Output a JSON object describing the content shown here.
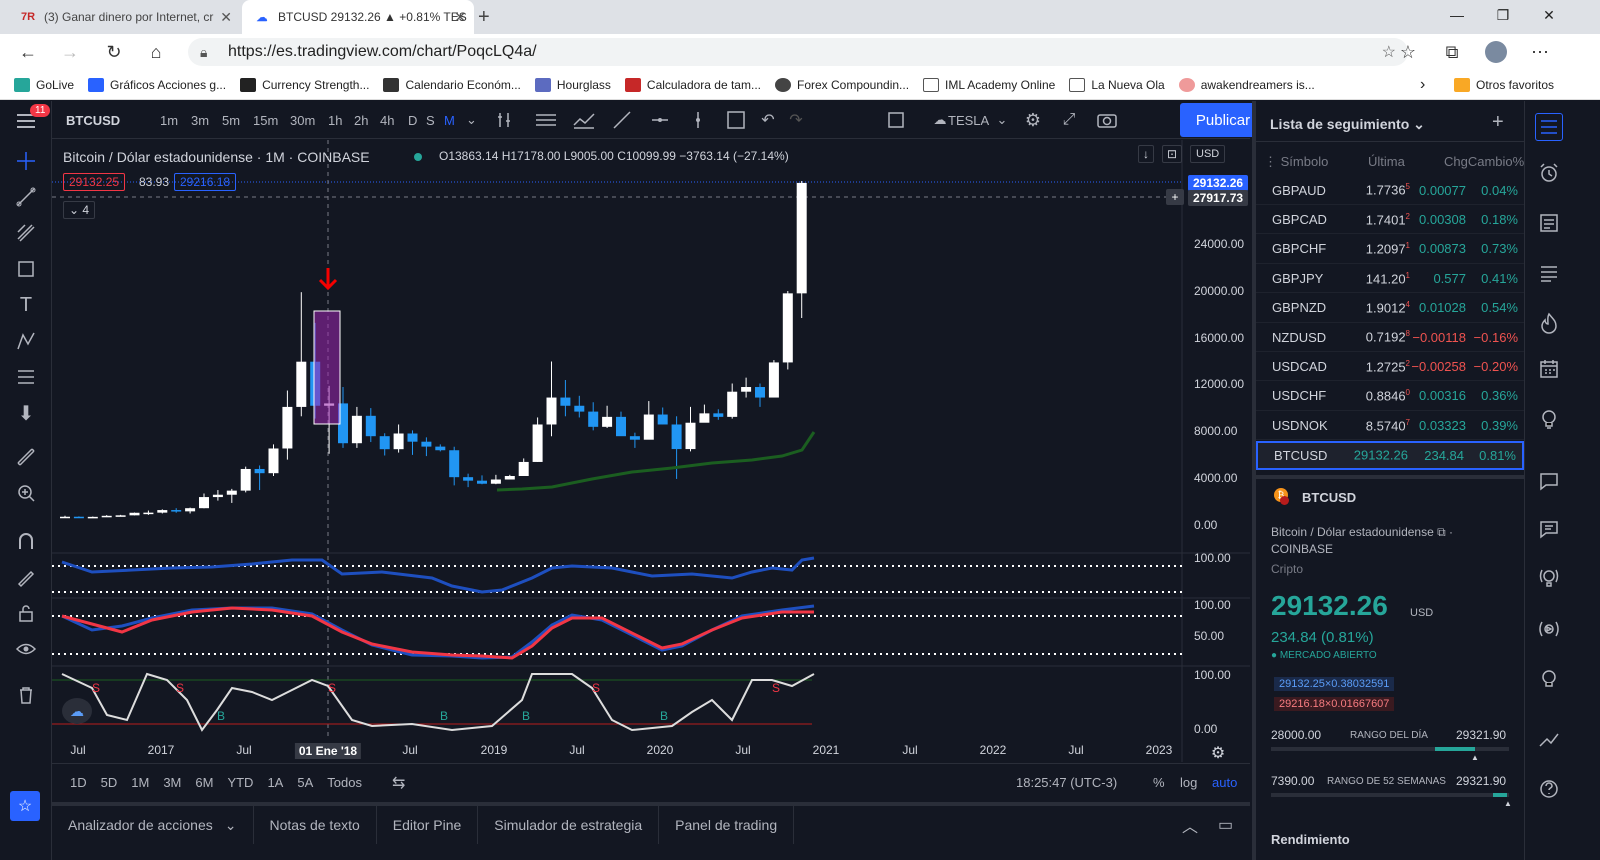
{
  "browser": {
    "tabs": [
      {
        "title": "(3) Ganar dinero por Internet, cr"
      },
      {
        "title": "BTCUSD 29132.26 ▲ +0.81% TES"
      }
    ],
    "url": "https://es.tradingview.com/chart/PoqcLQ4a/",
    "bookmarks": [
      "GoLive",
      "Gráficos Acciones g...",
      "Currency Strength...",
      "Calendario Económ...",
      "Hourglass",
      "Calculadora de tam...",
      "Forex Compoundin...",
      "IML Academy Online",
      "La Nueva Ola",
      "awakendreamers is..."
    ],
    "other_bookmarks": "Otros favoritos",
    "notification_count": "11"
  },
  "toolbar": {
    "symbol": "BTCUSD",
    "intervals": [
      "1m",
      "3m",
      "5m",
      "15m",
      "30m",
      "1h",
      "2h",
      "4h",
      "D",
      "S",
      "M"
    ],
    "active_interval": "M",
    "layout_name": "TESLA",
    "publish_label": "Publicar"
  },
  "chart": {
    "title": "Bitcoin / Dólar estadounidense · 1M · COINBASE",
    "ohlc": {
      "o": "O13863.14",
      "h": "H17178.00",
      "l": "L9005.00",
      "c": "C10099.99",
      "chg": "−3763.14 (−27.14%)"
    },
    "bid": "29132.25",
    "spread": "83.93",
    "ask": "29216.18",
    "indicators_count": "4",
    "currency": "USD",
    "last_price_label": "29132.26",
    "crosshair_price_label": "27917.73",
    "price_ticks": [
      "24000.00",
      "20000.00",
      "16000.00",
      "12000.00",
      "8000.00",
      "4000.00",
      "0.00"
    ],
    "osc1_ticks": [
      "100.00"
    ],
    "osc2_ticks": [
      "100.00",
      "50.00"
    ],
    "osc3_ticks": [
      "100.00",
      "0.00"
    ],
    "x_labels": [
      "Jul",
      "2017",
      "Jul",
      "Jul",
      "2019",
      "Jul",
      "2020",
      "Jul",
      "2021",
      "Jul",
      "2022",
      "Jul",
      "2023"
    ],
    "crosshair_date": "01 Ene '18",
    "signal_s": "S",
    "signal_b": "B",
    "colors": {
      "up": "#ffffff",
      "down": "#2196f3",
      "ma": "#1b5e20",
      "osc_blue": "#1e4fbf",
      "osc_red": "#f23645"
    }
  },
  "chart_data": {
    "type": "candlestick",
    "title": "Bitcoin / Dólar estadounidense · 1M · COINBASE",
    "ylim": [
      0,
      30000
    ],
    "candles_approx": [
      {
        "date": "2016-07",
        "close": 620
      },
      {
        "date": "2017-01",
        "close": 970
      },
      {
        "date": "2017-07",
        "close": 2850
      },
      {
        "date": "2017-12",
        "close": 13863
      },
      {
        "date": "2018-01",
        "close": 10100
      },
      {
        "date": "2018-12",
        "close": 3700
      },
      {
        "date": "2019-06",
        "close": 10800
      },
      {
        "date": "2020-03",
        "close": 6400
      },
      {
        "date": "2020-11",
        "close": 19700
      },
      {
        "date": "2020-12",
        "close": 29132
      }
    ],
    "last": 29132.26
  },
  "range_bar": {
    "ranges": [
      "1D",
      "5D",
      "1M",
      "3M",
      "6M",
      "YTD",
      "1A",
      "5A",
      "Todos"
    ],
    "time": "18:25:47 (UTC-3)",
    "pct": "%",
    "log": "log",
    "auto": "auto"
  },
  "bottom_tabs": [
    "Analizador de acciones",
    "Notas de texto",
    "Editor Pine",
    "Simulador de estrategia",
    "Panel de trading"
  ],
  "watchlist": {
    "title": "Lista de seguimiento",
    "headers": {
      "symbol": "Símbolo",
      "last": "Última",
      "chg": "ChgCambio%"
    },
    "rows": [
      {
        "s": "GBPAUD",
        "l": "1.7736",
        "ls": "5",
        "c": "0.00077",
        "p": "0.04%",
        "pos": true
      },
      {
        "s": "GBPCAD",
        "l": "1.7401",
        "ls": "2",
        "c": "0.00308",
        "p": "0.18%",
        "pos": true
      },
      {
        "s": "GBPCHF",
        "l": "1.2097",
        "ls": "1",
        "c": "0.00873",
        "p": "0.73%",
        "pos": true
      },
      {
        "s": "GBPJPY",
        "l": "141.20",
        "ls": "1",
        "c": "0.577",
        "p": "0.41%",
        "pos": true
      },
      {
        "s": "GBPNZD",
        "l": "1.9012",
        "ls": "4",
        "c": "0.01028",
        "p": "0.54%",
        "pos": true
      },
      {
        "s": "NZDUSD",
        "l": "0.7192",
        "ls": "8",
        "c": "−0.00118",
        "p": "−0.16%",
        "pos": false
      },
      {
        "s": "USDCAD",
        "l": "1.2725",
        "ls": "2",
        "c": "−0.00258",
        "p": "−0.20%",
        "pos": false
      },
      {
        "s": "USDCHF",
        "l": "0.8846",
        "ls": "0",
        "c": "0.00316",
        "p": "0.36%",
        "pos": true
      },
      {
        "s": "USDNOK",
        "l": "8.5740",
        "ls": "7",
        "c": "0.03323",
        "p": "0.39%",
        "pos": true
      },
      {
        "s": "BTCUSD",
        "l": "29132.26",
        "ls": "",
        "c": "234.84",
        "p": "0.81%",
        "pos": true
      }
    ]
  },
  "details": {
    "symbol": "BTCUSD",
    "name": "Bitcoin / Dólar estadounidense",
    "exchange": "COINBASE",
    "type": "Cripto",
    "price": "29132.26",
    "currency": "USD",
    "change": "234.84 (0.81%)",
    "market_status": "MERCADO ABIERTO",
    "bid": "29132.25×0.38032591",
    "ask": "29216.18×0.01667607",
    "day_low": "28000.00",
    "day_label": "RANGO DEL DÍA",
    "day_high": "29321.90",
    "week_low": "7390.00",
    "week_label": "RANGO DE 52 SEMANAS",
    "week_high": "29321.90",
    "performance": "Rendimiento"
  }
}
